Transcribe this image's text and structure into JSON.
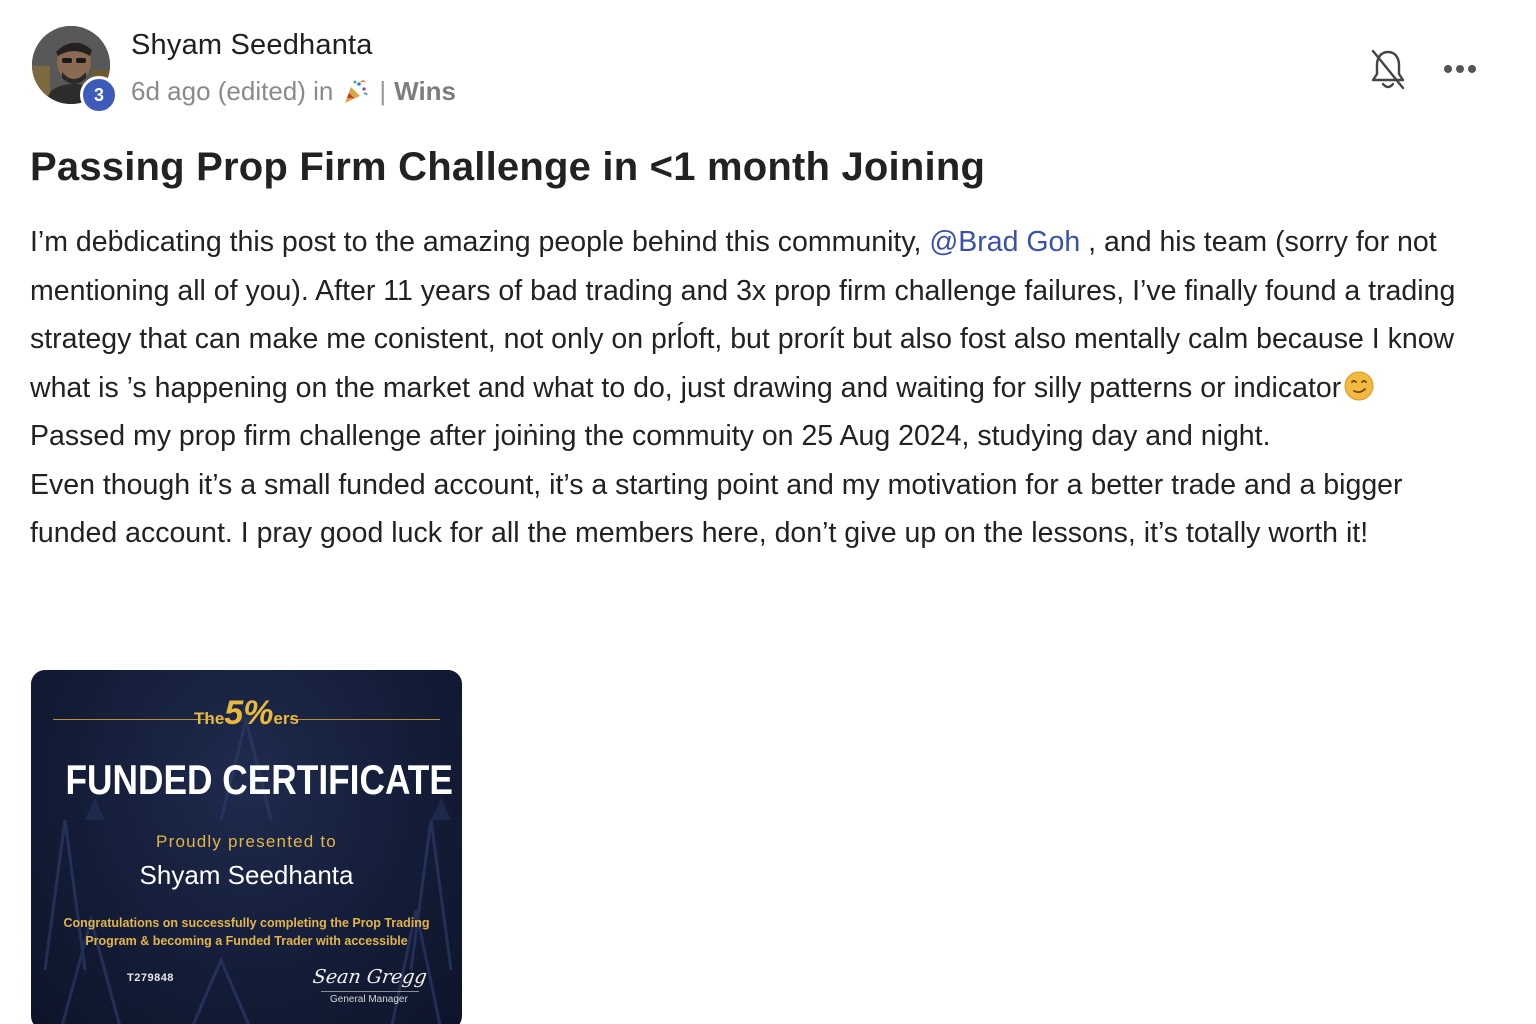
{
  "author": {
    "name": "Shyam Seedhanta",
    "level": "3"
  },
  "meta": {
    "time": "6d ago (edited) in",
    "category_icon": "party-popper-icon",
    "separator": "|",
    "category": "Wins"
  },
  "actions": {
    "notifications_icon": "bell-off-icon",
    "more_icon": "more-horizontal-icon"
  },
  "post": {
    "title": "Passing Prop Firm Challenge in <1 month Joining",
    "body": {
      "intro_before_mention": "I’m deḃdicating this post to the amazing people behind this community, ",
      "mention": "@Brad Goh",
      "intro_after_mention": " , and his team (sorry for not mentioning all of you). After 11 years of bad trading and 3x prop firm challenge failures, I’ve finally found a trading strategy that can make me conistent, not only on prĺoft, but prorít but also fost also mentally calm because I know what is ’s happening on the market and what to do, just drawing and waiting for silly patterns or indicator",
      "emoji": "smirking-face-emoji",
      "line2": "Passed my prop firm challenge after joiṅing the commuity on 25 Aug 2024, studying day and night.",
      "line3": "Even though it’s a small funded account, it’s a starting point and my motivation for a better trade and a bigger funded account. I pray good luck for all the members here, don’t give up on the lessons, it’s totally worth it!"
    }
  },
  "certificate": {
    "brand_the": "The",
    "brand_five": "5%",
    "brand_ers": "ers",
    "title": "FUNDED CERTIFICATE",
    "presented": "Proudly presented to",
    "recipient": "Shyam Seedhanta",
    "congrats": "Congratulations on successfully completing the Prop Trading Program & becoming a Funded Trader with accessible",
    "id": "T279848",
    "signature": "Sean Gregg",
    "signer_title": "General Manager",
    "accent_color": "#e3b449"
  },
  "colors": {
    "mention": "#3a52a6",
    "badge": "#3d5bb8"
  }
}
